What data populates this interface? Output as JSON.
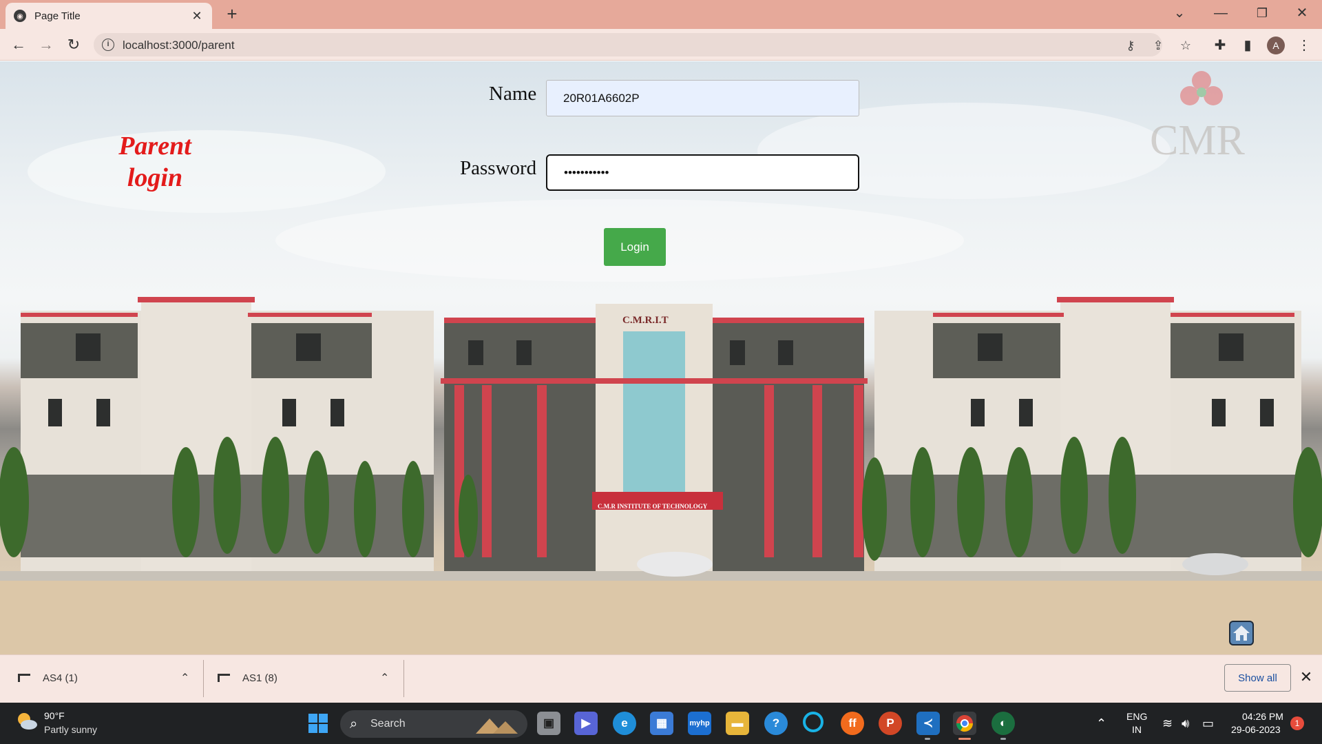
{
  "browser": {
    "tab_title": "Page Title",
    "new_tab_symbol": "+",
    "url": "localhost:3000/parent",
    "avatar_letter": "A"
  },
  "page": {
    "heading_line1": "Parent",
    "heading_line2": "login",
    "name_label": "Name",
    "name_value": "20R01A6602P",
    "password_label": "Password",
    "password_value": "•••••••••••",
    "login_button": "Login",
    "watermark_logo_text": "CMR",
    "building_sign_top": "C.M.R.I.T",
    "building_sign_bottom": "C.M.R INSTITUTE OF TECHNOLOGY"
  },
  "download_shelf": {
    "items": [
      {
        "label": "AS4 (1)"
      },
      {
        "label": "AS1 (8)"
      }
    ],
    "show_all": "Show all"
  },
  "taskbar": {
    "weather_temp": "90°F",
    "weather_desc": "Partly sunny",
    "search_placeholder": "Search",
    "lang_line1": "ENG",
    "lang_line2": "IN",
    "time": "04:26 PM",
    "date": "29-06-2023",
    "notification_count": "1"
  },
  "colors": {
    "tabbar": "#e6a99a",
    "heading_red": "#e31b1b",
    "login_green": "#45a94a",
    "autofill_blue": "#e8f0fe",
    "taskbar": "#202224"
  }
}
